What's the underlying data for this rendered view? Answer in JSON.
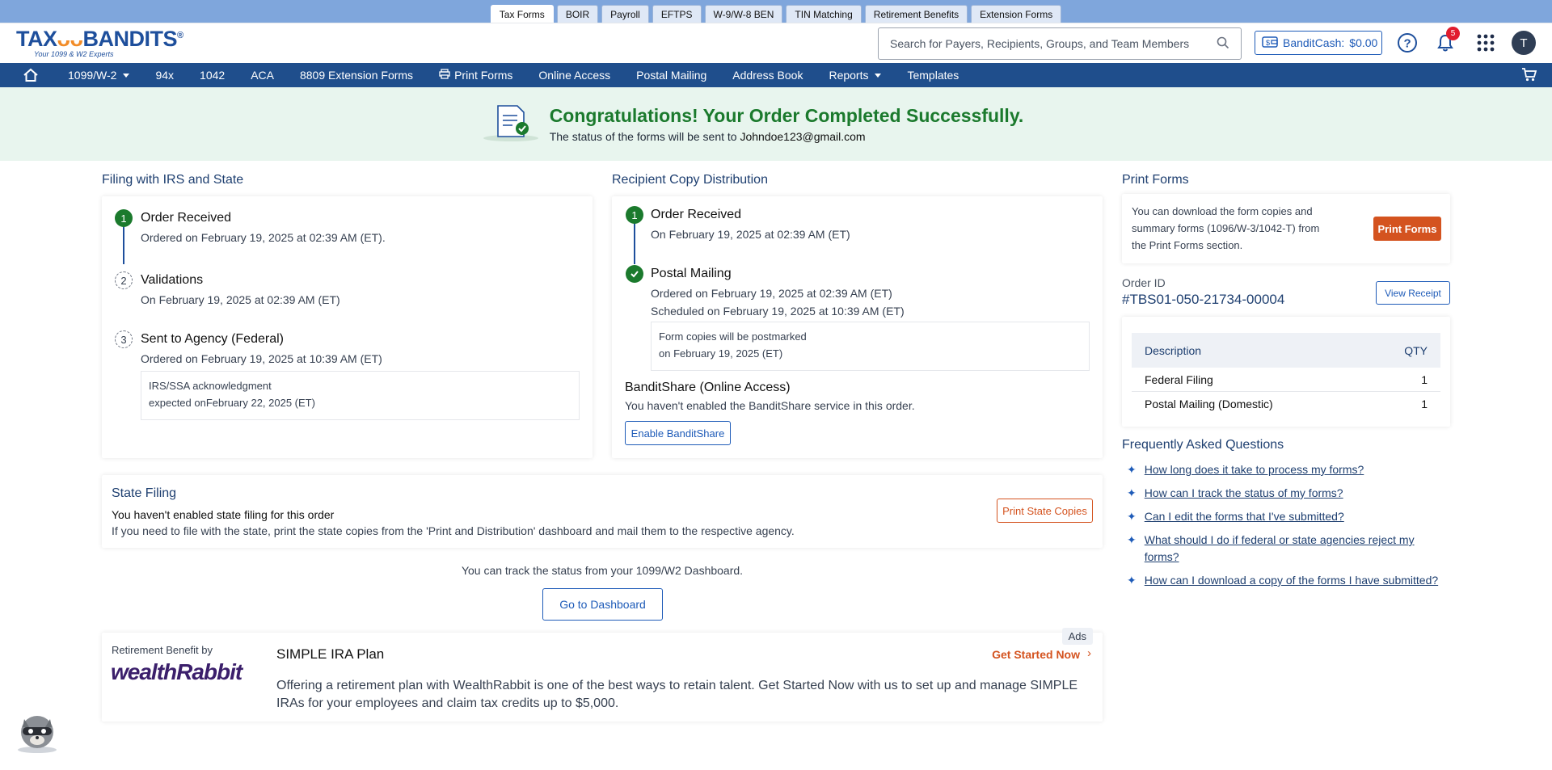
{
  "top_tabs": [
    "Tax Forms",
    "BOIR",
    "Payroll",
    "EFTPS",
    "W-9/W-8 BEN",
    "TIN Matching",
    "Retirement Benefits",
    "Extension Forms"
  ],
  "active_tab": "Tax Forms",
  "logo": {
    "part1": "TAX",
    "part2": "BANDITS",
    "reg": "®",
    "tagline": "Your 1099 & W2 Experts"
  },
  "search": {
    "placeholder": "Search for Payers, Recipients, Groups, and Team Members"
  },
  "banditcash": {
    "label": "BanditCash:",
    "amount": "$0.00"
  },
  "notifications": {
    "count": "5"
  },
  "avatar_initial": "T",
  "nav": {
    "items": [
      {
        "label": "1099/W-2",
        "dropdown": true
      },
      {
        "label": "94x",
        "dropdown": false
      },
      {
        "label": "1042",
        "dropdown": false
      },
      {
        "label": "ACA",
        "dropdown": false
      },
      {
        "label": "8809 Extension Forms",
        "dropdown": false
      },
      {
        "label": "Print Forms",
        "dropdown": false,
        "icon": "printer-icon"
      },
      {
        "label": "Online Access",
        "dropdown": false
      },
      {
        "label": "Postal Mailing",
        "dropdown": false
      },
      {
        "label": "Address Book",
        "dropdown": false
      },
      {
        "label": "Reports",
        "dropdown": true
      },
      {
        "label": "Templates",
        "dropdown": false
      }
    ]
  },
  "banner": {
    "title": "Congratulations! Your Order Completed Successfully.",
    "subtitle_prefix": "The status of the forms will be sent to",
    "email": "Johndoe123@gmail.com"
  },
  "irs_state": {
    "title": "Filing with IRS and State",
    "steps": [
      {
        "num": "1",
        "title": "Order Received",
        "sub": "Ordered on February 19, 2025 at 02:39 AM (ET)."
      },
      {
        "num": "2",
        "title": "Validations",
        "sub": "On February 19, 2025 at 02:39 AM (ET)"
      },
      {
        "num": "3",
        "title": "Sent to Agency (Federal)",
        "sub": "Ordered on February 19, 2025 at 10:39 AM (ET)"
      }
    ],
    "note_line1": "IRS/SSA acknowledgment",
    "note_line2": "expected onFebruary 22, 2025 (ET)"
  },
  "recipient": {
    "title": "Recipient Copy Distribution",
    "step1": {
      "num": "1",
      "title": "Order Received",
      "sub": "On February 19, 2025 at 02:39 AM (ET)"
    },
    "step2": {
      "title": "Postal Mailing",
      "sub1": "Ordered on February 19, 2025 at 02:39 AM (ET)",
      "sub2": "Scheduled on February 19, 2025 at 10:39 AM (ET)"
    },
    "note_line1": "Form copies will be postmarked",
    "note_line2": "on February 19, 2025 (ET)",
    "bandit_share_title": "BanditShare (Online Access)",
    "bandit_share_sub": "You haven't enabled the BanditShare service in this order.",
    "enable_button": "Enable BanditShare"
  },
  "state_filing": {
    "title": "State Filing",
    "line1": "You haven't enabled state filing for this order",
    "line2": "If you need to file with the state, print the state copies from the 'Print and Distribution' dashboard and mail them to the respective agency.",
    "button": "Print State Copies"
  },
  "track_text": "You can track the status from your 1099/W2 Dashboard.",
  "dashboard_button": "Go to Dashboard",
  "ad": {
    "ads_label": "Ads",
    "by_label": "Retirement Benefit by",
    "brand": "wealthRabbit",
    "title": "SIMPLE IRA Plan",
    "cta": "Get Started Now",
    "body": "Offering a retirement plan with WealthRabbit is one of the best ways to retain talent. Get Started Now with us to set up and manage SIMPLE IRAs for your employees and claim tax credits up to $5,000."
  },
  "print_forms": {
    "title": "Print Forms",
    "text": "You can download the form copies and summary forms (1096/W-3/1042-T) from the Print Forms section.",
    "button": "Print Forms"
  },
  "order": {
    "label": "Order ID",
    "id": "#TBS01-050-21734-00004",
    "receipt_button": "View Receipt",
    "table_headers": [
      "Description",
      "QTY"
    ],
    "rows": [
      {
        "description": "Federal Filing",
        "qty": "1"
      },
      {
        "description": "Postal Mailing (Domestic)",
        "qty": "1"
      }
    ]
  },
  "faq": {
    "title": "Frequently Asked Questions",
    "items": [
      "How long does it take to process my forms?",
      "How can I track the status of my forms?",
      "Can I edit the forms that I've submitted?",
      "What should I do if federal or state agencies reject my forms?",
      "How can I download a copy of the forms I have submitted?"
    ]
  },
  "colors": {
    "primary": "#1f4e8c",
    "success": "#1b7a2d",
    "accent": "#d4531f",
    "banner_bg": "#e8f5ee"
  }
}
